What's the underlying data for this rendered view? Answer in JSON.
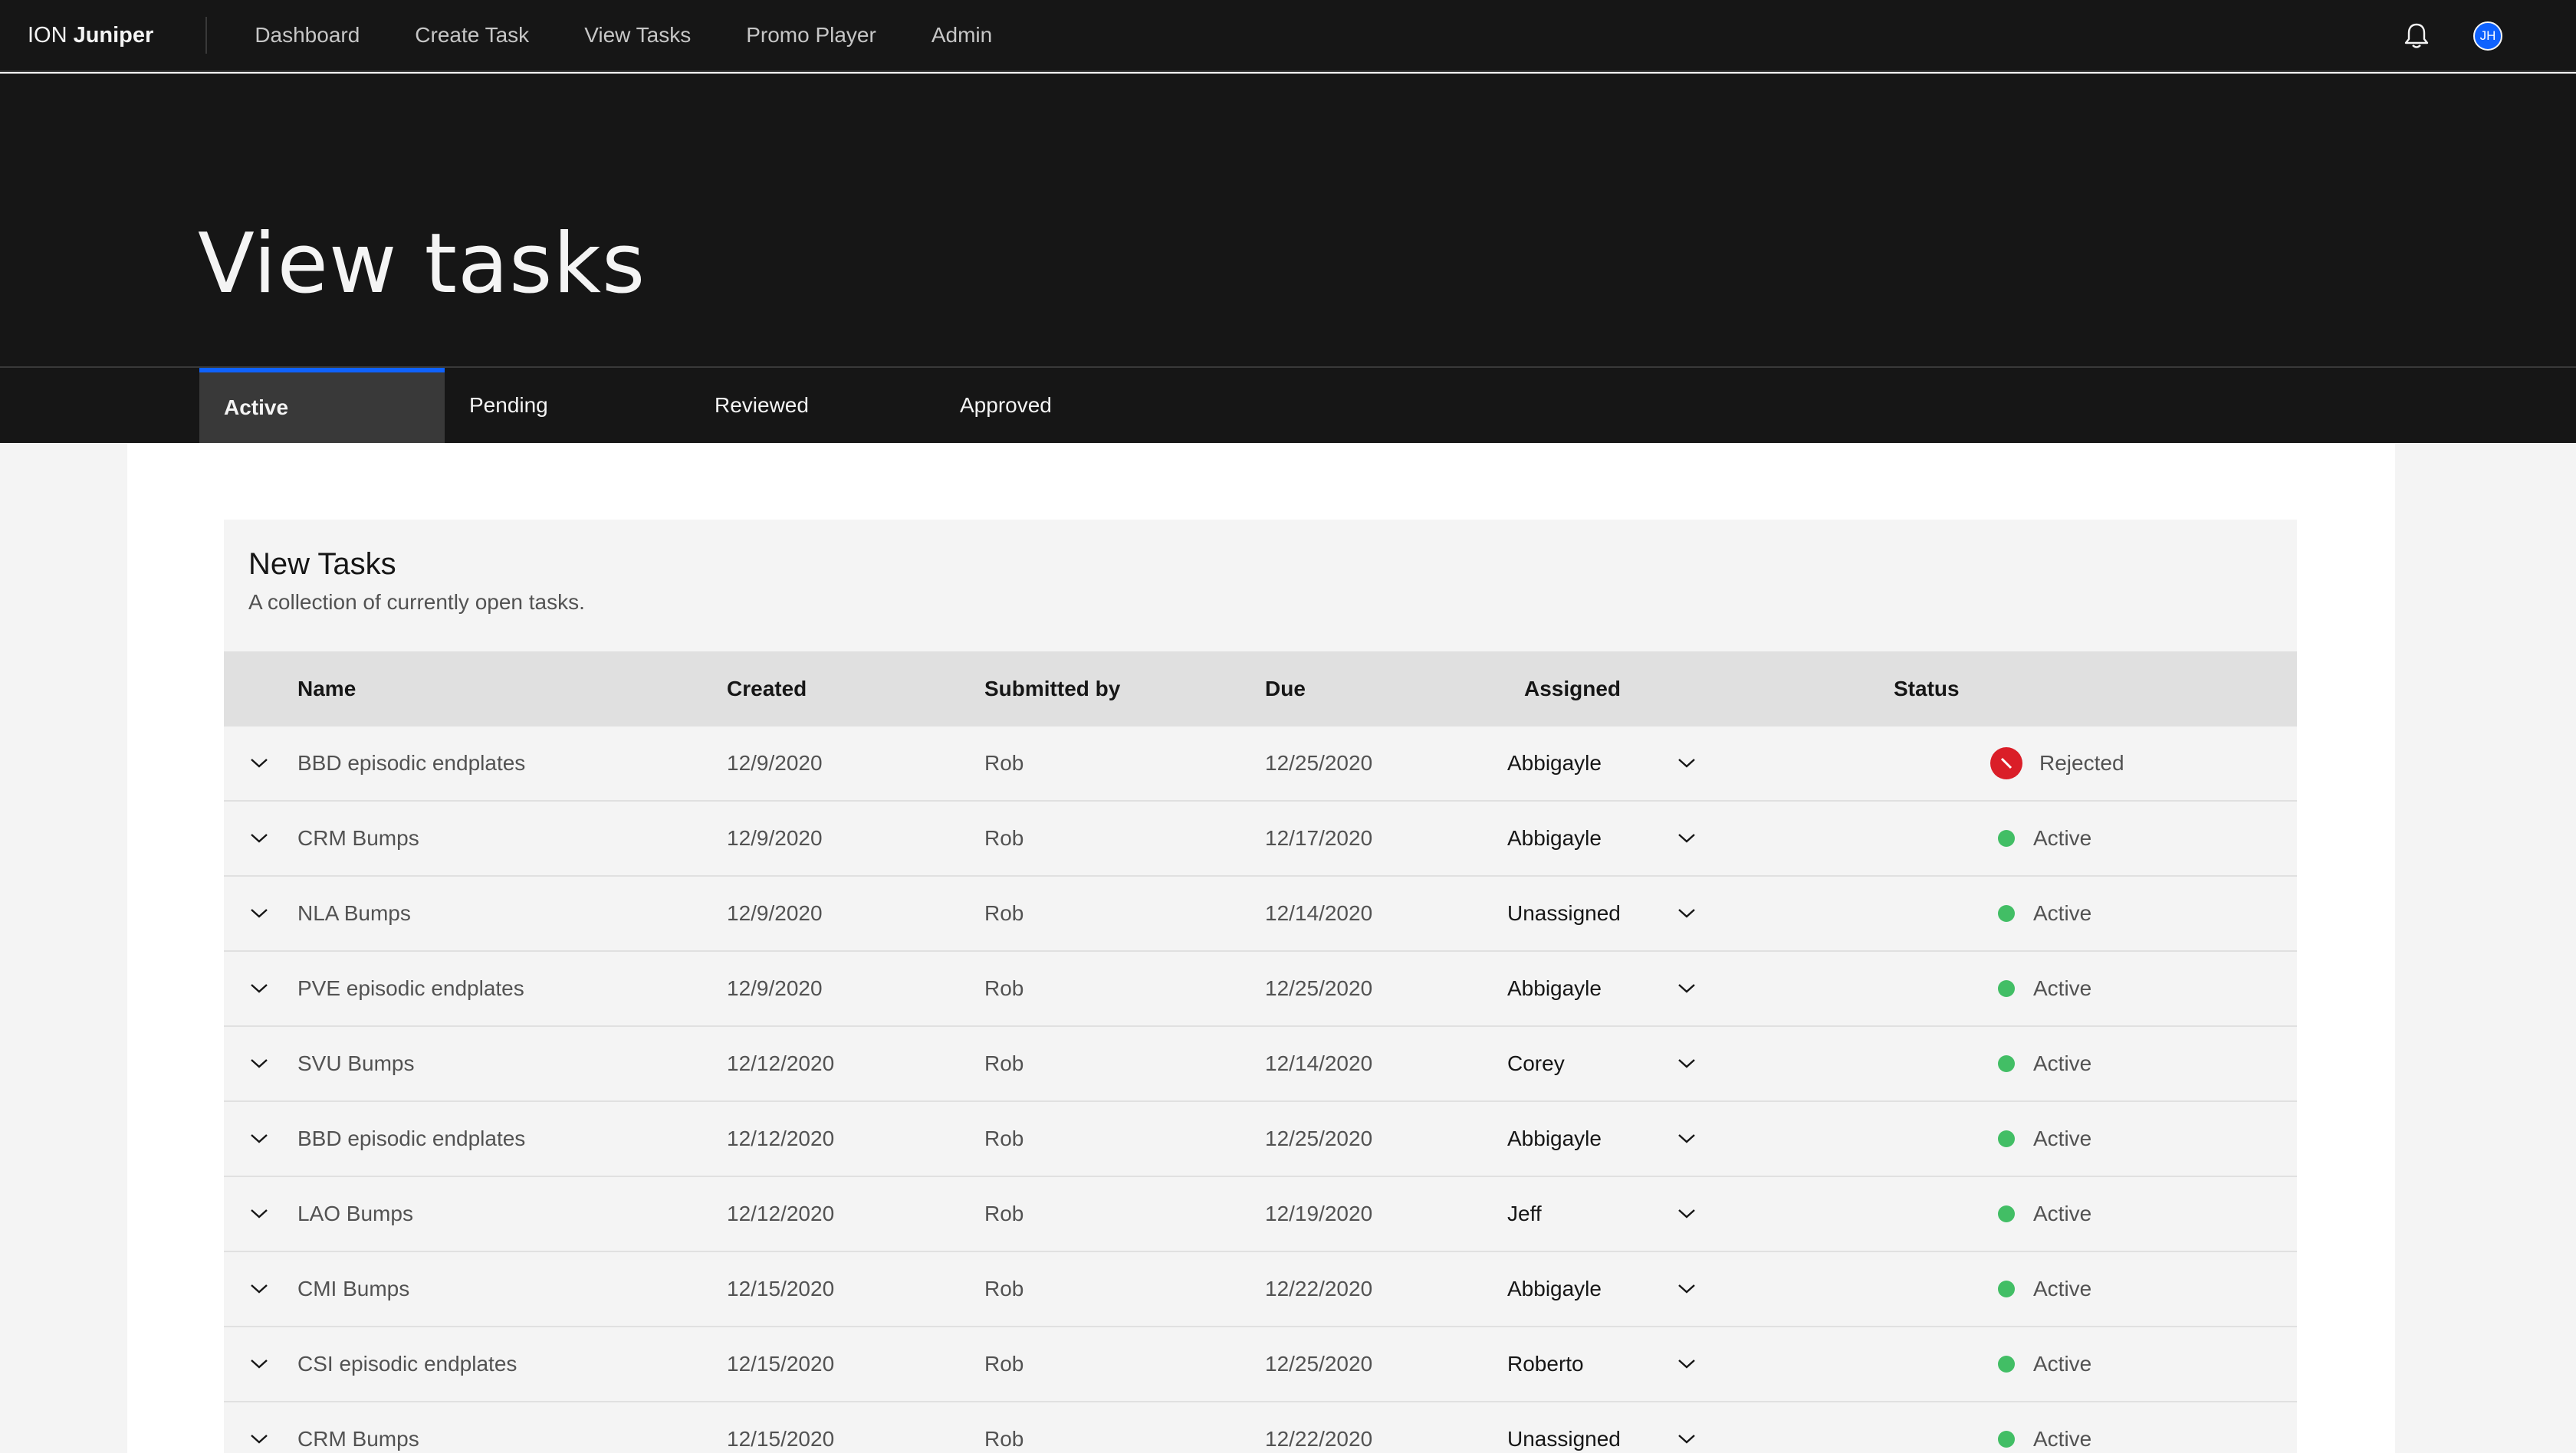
{
  "nav": {
    "brand_prefix": "ION",
    "brand_name": "Juniper",
    "items": [
      "Dashboard",
      "Create Task",
      "View Tasks",
      "Promo Player",
      "Admin"
    ],
    "avatar_initials": "JH"
  },
  "hero": {
    "title": "View tasks"
  },
  "tabs": [
    {
      "label": "Active",
      "selected": true
    },
    {
      "label": "Pending",
      "selected": false
    },
    {
      "label": "Reviewed",
      "selected": false
    },
    {
      "label": "Approved",
      "selected": false
    }
  ],
  "table": {
    "title": "New Tasks",
    "description": "A collection of currently open tasks.",
    "headers": {
      "name": "Name",
      "created": "Created",
      "submitted_by": "Submitted by",
      "due": "Due",
      "assigned": "Assigned",
      "status": "Status"
    },
    "rows": [
      {
        "name": "BBD episodic endplates",
        "created": "12/9/2020",
        "submitted_by": "Rob",
        "due": "12/25/2020",
        "assigned": "Abbigayle",
        "status": "Rejected"
      },
      {
        "name": "CRM Bumps",
        "created": "12/9/2020",
        "submitted_by": "Rob",
        "due": "12/17/2020",
        "assigned": "Abbigayle",
        "status": "Active"
      },
      {
        "name": "NLA Bumps",
        "created": "12/9/2020",
        "submitted_by": "Rob",
        "due": "12/14/2020",
        "assigned": "Unassigned",
        "status": "Active"
      },
      {
        "name": "PVE episodic endplates",
        "created": "12/9/2020",
        "submitted_by": "Rob",
        "due": "12/25/2020",
        "assigned": "Abbigayle",
        "status": "Active"
      },
      {
        "name": "SVU Bumps",
        "created": "12/12/2020",
        "submitted_by": "Rob",
        "due": "12/14/2020",
        "assigned": "Corey",
        "status": "Active"
      },
      {
        "name": "BBD episodic endplates",
        "created": "12/12/2020",
        "submitted_by": "Rob",
        "due": "12/25/2020",
        "assigned": "Abbigayle",
        "status": "Active"
      },
      {
        "name": "LAO Bumps",
        "created": "12/12/2020",
        "submitted_by": "Rob",
        "due": "12/19/2020",
        "assigned": "Jeff",
        "status": "Active"
      },
      {
        "name": "CMI Bumps",
        "created": "12/15/2020",
        "submitted_by": "Rob",
        "due": "12/22/2020",
        "assigned": "Abbigayle",
        "status": "Active"
      },
      {
        "name": "CSI episodic endplates",
        "created": "12/15/2020",
        "submitted_by": "Rob",
        "due": "12/25/2020",
        "assigned": "Roberto",
        "status": "Active"
      },
      {
        "name": "CRM Bumps",
        "created": "12/15/2020",
        "submitted_by": "Rob",
        "due": "12/22/2020",
        "assigned": "Unassigned",
        "status": "Active"
      }
    ]
  },
  "colors": {
    "status_active": "#42be65",
    "status_rejected": "#da1e28",
    "tab_accent": "#0f62fe",
    "header_bg": "#161616"
  }
}
